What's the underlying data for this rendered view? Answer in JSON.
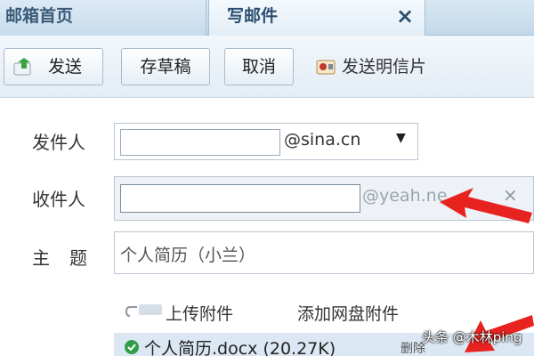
{
  "tabs": {
    "inbox": "邮箱首页",
    "compose": "写邮件",
    "close_glyph": "×"
  },
  "toolbar": {
    "send": "发送",
    "draft": "存草稿",
    "cancel": "取消",
    "postcard": "发送明信片"
  },
  "form": {
    "from_label": "发件人",
    "from_domain": "@sina.cn",
    "to_label": "收件人",
    "to_domain": "@yeah.ne",
    "subject_label": "主题",
    "subject_value": "个人简历（小兰）",
    "upload_attachment": "上传附件",
    "add_netdisk_attachment": "添加网盘附件",
    "attachment_file": "个人简历.docx (20.27K)",
    "attachment_delete": "删除"
  },
  "watermark": "头条 @木林ping",
  "icons": [
    "send-icon",
    "postcard-icon",
    "paperclip-icon",
    "file-icon",
    "close-icon",
    "chevron-down-icon"
  ],
  "colors": {
    "tab_bar": "#c2d8ea",
    "annotation_arrow": "#e8231f"
  }
}
